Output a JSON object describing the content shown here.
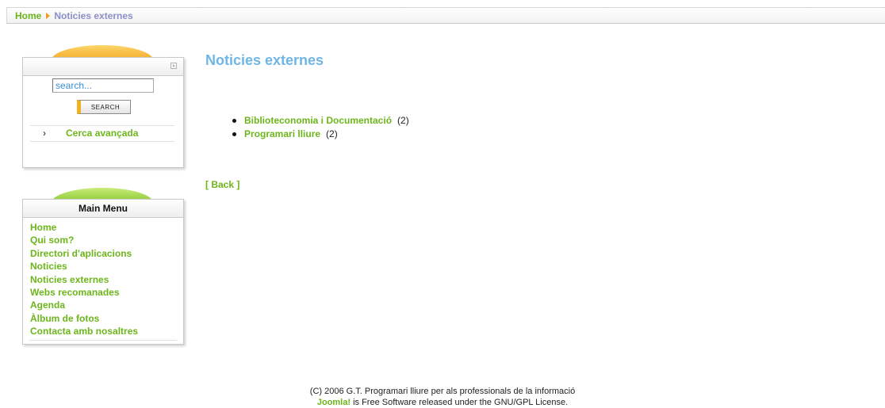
{
  "breadcrumb": {
    "home": "Home",
    "current": "Noticies externes"
  },
  "search_module": {
    "input_value": "search...",
    "button_label": "SEARCH",
    "advanced_arrow": "›",
    "advanced_label": "Cerca avançada"
  },
  "main_menu": {
    "title": "Main Menu",
    "items": [
      {
        "label": "Home"
      },
      {
        "label": "Qui som?"
      },
      {
        "label": "Directori d'aplicacions"
      },
      {
        "label": "Noticies"
      },
      {
        "label": "Noticies externes"
      },
      {
        "label": "Webs recomanades"
      },
      {
        "label": "Agenda"
      },
      {
        "label": "Àlbum de fotos"
      },
      {
        "label": "Contacta amb nosaltres"
      }
    ]
  },
  "content": {
    "title": "Noticies externes",
    "categories": [
      {
        "label": "Biblioteconomia i Documentació",
        "count": "(2)"
      },
      {
        "label": "Programari lliure",
        "count": "(2)"
      }
    ],
    "back_label": "[ Back ]"
  },
  "footer": {
    "line1": "(C) 2006 G.T. Programari lliure per als professionals de la informació",
    "joomla_link": "Joomla!",
    "line2_rest": " is Free Software released under the GNU/GPL License."
  },
  "colors": {
    "link_green": "#6cb51a",
    "title_blue": "#6eb6e6",
    "breadcrumb_current": "#8b8fc9",
    "accent_orange": "#f3a51c"
  },
  "icons": {
    "breadcrumb_separator": "triangle-right-icon",
    "module_expand": "expand-icon"
  }
}
